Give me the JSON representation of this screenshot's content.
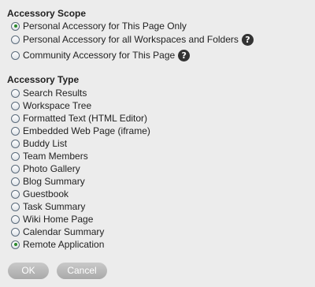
{
  "scope": {
    "heading": "Accessory Scope",
    "options": [
      {
        "label": "Personal Accessory for This Page Only",
        "checked": true,
        "help": false
      },
      {
        "label": "Personal Accessory for all Workspaces and Folders",
        "checked": false,
        "help": true
      },
      {
        "label": "Community Accessory for This Page",
        "checked": false,
        "help": true
      }
    ]
  },
  "type": {
    "heading": "Accessory Type",
    "options": [
      {
        "label": "Search Results",
        "checked": false
      },
      {
        "label": "Workspace Tree",
        "checked": false
      },
      {
        "label": "Formatted Text (HTML Editor)",
        "checked": false
      },
      {
        "label": "Embedded Web Page (iframe)",
        "checked": false
      },
      {
        "label": "Buddy List",
        "checked": false
      },
      {
        "label": "Team Members",
        "checked": false
      },
      {
        "label": "Photo Gallery",
        "checked": false
      },
      {
        "label": "Blog Summary",
        "checked": false
      },
      {
        "label": "Guestbook",
        "checked": false
      },
      {
        "label": "Task Summary",
        "checked": false
      },
      {
        "label": "Wiki Home Page",
        "checked": false
      },
      {
        "label": "Calendar Summary",
        "checked": false
      },
      {
        "label": "Remote Application",
        "checked": true
      }
    ]
  },
  "help_icon_glyph": "?",
  "buttons": {
    "ok_label": "OK",
    "cancel_label": "Cancel"
  }
}
